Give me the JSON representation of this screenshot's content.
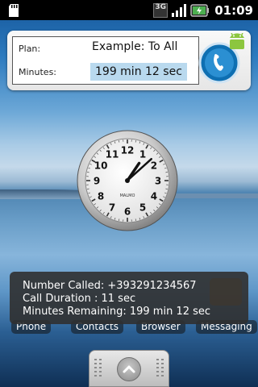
{
  "status_bar": {
    "time": "01:09",
    "network_type": "3G",
    "icons": [
      "sd-card-icon",
      "network-3g-icon",
      "signal-icon",
      "battery-charging-icon"
    ]
  },
  "widget": {
    "plan_label": "Plan:",
    "plan_value": "Example: To All",
    "minutes_label": "Minutes:",
    "minutes_value": "199 min 12 sec",
    "app_icon": "android-phone-icon"
  },
  "clock": {
    "brand": "MALMO",
    "numerals": [
      "12",
      "1",
      "2",
      "3",
      "4",
      "5",
      "6",
      "7",
      "8",
      "9",
      "10",
      "11"
    ],
    "time_shown": "1:08"
  },
  "toast": {
    "number_called": "Number Called: +393291234567",
    "call_duration": "Call Duration :    11 sec",
    "minutes_remaining": "Minutes Remaining: 199 min 12 sec"
  },
  "dock": {
    "phone": "Phone",
    "contacts": "Contacts",
    "browser": "Browser",
    "messaging": "Messaging"
  },
  "colors": {
    "toast_bg": "#303030",
    "highlight": "#b9d9ee",
    "status_bar": "#000000"
  }
}
